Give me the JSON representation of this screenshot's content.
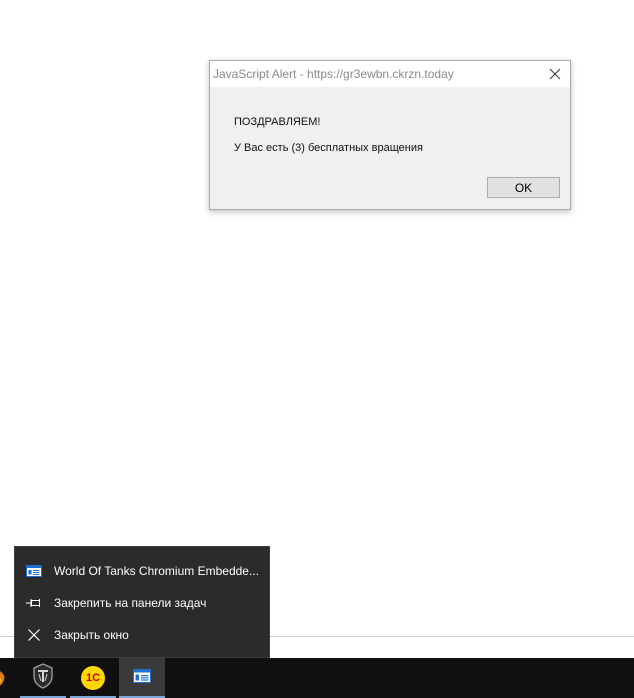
{
  "alert": {
    "title": "JavaScript Alert - https://gr3ewbn.ckrzn.today",
    "message_line1": "ПОЗДРАВЛЯЕМ!",
    "message_line2": "У Вас есть (3) бесплатных вращения",
    "ok_label": "OK"
  },
  "jumplist": {
    "items": [
      {
        "label": "World Of Tanks Chromium Embedde...",
        "icon": "app-window-icon"
      },
      {
        "label": "Закрепить на панели задач",
        "icon": "pin-icon"
      },
      {
        "label": "Закрыть окно",
        "icon": "close-icon"
      }
    ]
  },
  "taskbar": {
    "items": [
      {
        "icon": "partial-app-icon",
        "active": false
      },
      {
        "icon": "world-of-tanks-icon",
        "active": false
      },
      {
        "icon": "1c-icon",
        "label": "1С",
        "active": false
      },
      {
        "icon": "app-window-icon",
        "active": true
      }
    ]
  },
  "colors": {
    "dialog_bg": "#f0f0f0",
    "titlebar_bg": "#ffffff",
    "jumplist_bg": "#2b2b2b",
    "taskbar_bg": "#101010",
    "taskbar_accent": "#7aa7d8",
    "onec_yellow": "#ffd800",
    "onec_red": "#d00000"
  }
}
